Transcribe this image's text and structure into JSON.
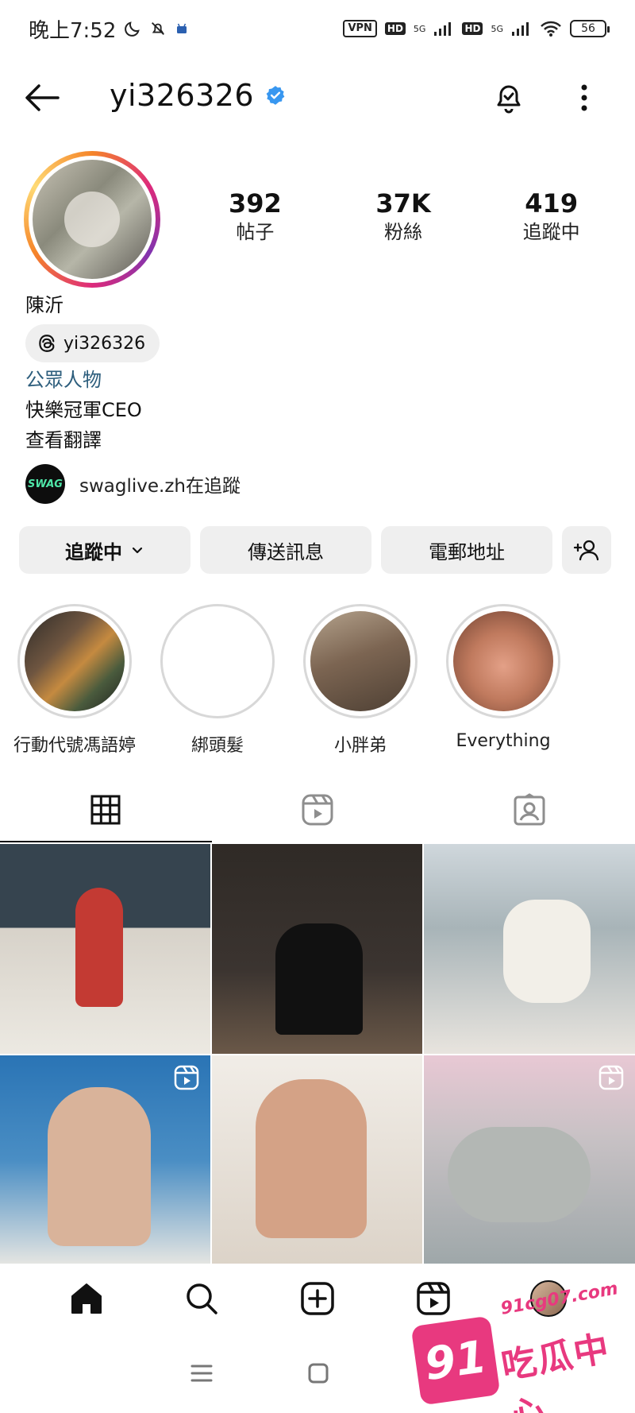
{
  "status_bar": {
    "time": "晚上7:52",
    "vpn": "VPN",
    "hd1": "HD",
    "hd2": "HD",
    "net1": "5G",
    "net2": "5G",
    "battery": "56"
  },
  "header": {
    "username": "yi326326",
    "verified": true
  },
  "profile": {
    "stats": [
      {
        "value": "392",
        "label": "帖子"
      },
      {
        "value": "37K",
        "label": "粉絲"
      },
      {
        "value": "419",
        "label": "追蹤中"
      }
    ],
    "full_name": "陳沂",
    "threads_handle": "yi326326",
    "category": "公眾人物",
    "bio_line1": "快樂冠軍CEO",
    "bio_line2": "查看翻譯",
    "followed_by": {
      "avatar_text": "SWAG",
      "text": "swaglive.zh在追蹤"
    }
  },
  "actions": {
    "following_label": "追蹤中",
    "message_label": "傳送訊息",
    "email_label": "電郵地址"
  },
  "highlights": [
    {
      "label": "行動代號馮語婷"
    },
    {
      "label": "綁頭髮"
    },
    {
      "label": "小胖弟"
    },
    {
      "label": "Everything"
    }
  ],
  "tabs": [
    {
      "icon": "grid-icon",
      "active": true
    },
    {
      "icon": "reels-icon",
      "active": false
    },
    {
      "icon": "tagged-icon",
      "active": false
    }
  ],
  "posts": [
    {
      "reel": false
    },
    {
      "reel": false
    },
    {
      "reel": false
    },
    {
      "reel": true
    },
    {
      "reel": false
    },
    {
      "reel": true
    }
  ],
  "bottom_nav": [
    "home-icon",
    "search-icon",
    "create-icon",
    "reels-icon",
    "profile-avatar"
  ],
  "watermark": {
    "badge": "91",
    "url": "91cg07.com",
    "text": "吃瓜中心"
  },
  "colors": {
    "category_link": "#2c5d7c",
    "button_bg": "#efefef",
    "verified_blue": "#3897f0",
    "watermark_pink": "#e8397f"
  }
}
